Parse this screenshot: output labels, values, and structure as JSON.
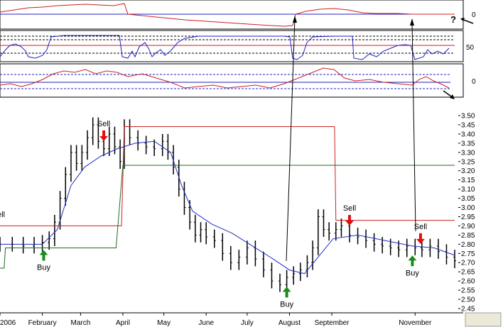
{
  "chart_data": {
    "type": "line",
    "grid": false,
    "legend": "none",
    "colors": {
      "price": "#000000",
      "moving_average": "#1f2fbf",
      "sell_stop": "#cc2222",
      "buy_stop": "#1e6b1e",
      "buy_arrow": "#1a8a1a",
      "sell_arrow": "#e01010",
      "indicator_line": "#cc2020",
      "indicator_blue": "#2020c0"
    },
    "x": {
      "type": "date",
      "range": [
        "2006-01-01",
        "2006-11-30"
      ],
      "ticks": [
        {
          "label": "2006",
          "date": "2006-01-01"
        },
        {
          "label": "February",
          "date": "2006-02-01"
        },
        {
          "label": "March",
          "date": "2006-03-01"
        },
        {
          "label": "April",
          "date": "2006-04-01"
        },
        {
          "label": "May",
          "date": "2006-05-01"
        },
        {
          "label": "June",
          "date": "2006-06-01"
        },
        {
          "label": "July",
          "date": "2006-07-01"
        },
        {
          "label": "August",
          "date": "2006-08-01"
        },
        {
          "label": "September",
          "date": "2006-09-01"
        },
        {
          "label": "November",
          "date": "2006-11-01"
        }
      ]
    },
    "y": {
      "range": [
        2.45,
        3.5
      ],
      "ticks": [
        "3.50",
        "3.45",
        "3.40",
        "3.35",
        "3.30",
        "3.25",
        "3.20",
        "3.15",
        "3.10",
        "3.05",
        "3.00",
        "2.95",
        "2.90",
        "2.85",
        "2.80",
        "2.75",
        "2.70",
        "2.65",
        "2.60",
        "2.55",
        "2.50",
        "2.45"
      ]
    },
    "price_series": [
      {
        "date": "2006-01-01",
        "value": 2.8
      },
      {
        "date": "2006-01-10",
        "value": 2.8
      },
      {
        "date": "2006-01-18",
        "value": 2.79
      },
      {
        "date": "2006-01-26",
        "value": 2.8
      },
      {
        "date": "2006-02-01",
        "value": 2.81
      },
      {
        "date": "2006-02-06",
        "value": 2.83
      },
      {
        "date": "2006-02-10",
        "value": 2.92
      },
      {
        "date": "2006-02-14",
        "value": 3.05
      },
      {
        "date": "2006-02-18",
        "value": 3.18
      },
      {
        "date": "2006-02-22",
        "value": 3.3
      },
      {
        "date": "2006-02-26",
        "value": 3.24
      },
      {
        "date": "2006-03-02",
        "value": 3.3
      },
      {
        "date": "2006-03-06",
        "value": 3.38
      },
      {
        "date": "2006-03-10",
        "value": 3.45
      },
      {
        "date": "2006-03-14",
        "value": 3.36
      },
      {
        "date": "2006-03-18",
        "value": 3.32
      },
      {
        "date": "2006-03-22",
        "value": 3.4
      },
      {
        "date": "2006-03-26",
        "value": 3.33
      },
      {
        "date": "2006-03-30",
        "value": 3.25
      },
      {
        "date": "2006-04-02",
        "value": 3.44
      },
      {
        "date": "2006-04-06",
        "value": 3.38
      },
      {
        "date": "2006-04-12",
        "value": 3.35
      },
      {
        "date": "2006-04-18",
        "value": 3.33
      },
      {
        "date": "2006-04-24",
        "value": 3.32
      },
      {
        "date": "2006-04-30",
        "value": 3.36
      },
      {
        "date": "2006-05-04",
        "value": 3.3
      },
      {
        "date": "2006-05-08",
        "value": 3.22
      },
      {
        "date": "2006-05-12",
        "value": 3.1
      },
      {
        "date": "2006-05-16",
        "value": 3.0
      },
      {
        "date": "2006-05-20",
        "value": 2.92
      },
      {
        "date": "2006-05-24",
        "value": 2.85
      },
      {
        "date": "2006-05-28",
        "value": 2.88
      },
      {
        "date": "2006-06-01",
        "value": 2.84
      },
      {
        "date": "2006-06-07",
        "value": 2.82
      },
      {
        "date": "2006-06-13",
        "value": 2.75
      },
      {
        "date": "2006-06-19",
        "value": 2.7
      },
      {
        "date": "2006-06-25",
        "value": 2.73
      },
      {
        "date": "2006-07-01",
        "value": 2.78
      },
      {
        "date": "2006-07-07",
        "value": 2.72
      },
      {
        "date": "2006-07-13",
        "value": 2.66
      },
      {
        "date": "2006-07-19",
        "value": 2.6
      },
      {
        "date": "2006-07-25",
        "value": 2.58
      },
      {
        "date": "2006-07-30",
        "value": 2.62
      },
      {
        "date": "2006-08-04",
        "value": 2.64
      },
      {
        "date": "2006-08-09",
        "value": 2.66
      },
      {
        "date": "2006-08-14",
        "value": 2.7
      },
      {
        "date": "2006-08-18",
        "value": 2.78
      },
      {
        "date": "2006-08-22",
        "value": 2.95
      },
      {
        "date": "2006-08-26",
        "value": 2.88
      },
      {
        "date": "2006-08-30",
        "value": 2.86
      },
      {
        "date": "2006-09-04",
        "value": 2.88
      },
      {
        "date": "2006-09-08",
        "value": 2.9
      },
      {
        "date": "2006-09-14",
        "value": 2.85
      },
      {
        "date": "2006-09-20",
        "value": 2.84
      },
      {
        "date": "2006-09-26",
        "value": 2.82
      },
      {
        "date": "2006-10-02",
        "value": 2.8
      },
      {
        "date": "2006-10-08",
        "value": 2.79
      },
      {
        "date": "2006-10-14",
        "value": 2.78
      },
      {
        "date": "2006-10-20",
        "value": 2.77
      },
      {
        "date": "2006-10-26",
        "value": 2.79
      },
      {
        "date": "2006-11-01",
        "value": 2.78
      },
      {
        "date": "2006-11-06",
        "value": 2.77
      },
      {
        "date": "2006-11-12",
        "value": 2.79
      },
      {
        "date": "2006-11-18",
        "value": 2.76
      },
      {
        "date": "2006-11-24",
        "value": 2.73
      },
      {
        "date": "2006-11-30",
        "value": 2.71
      }
    ],
    "moving_average": [
      {
        "date": "2006-01-01",
        "value": 2.8
      },
      {
        "date": "2006-02-01",
        "value": 2.8
      },
      {
        "date": "2006-02-12",
        "value": 2.88
      },
      {
        "date": "2006-02-22",
        "value": 3.12
      },
      {
        "date": "2006-03-04",
        "value": 3.22
      },
      {
        "date": "2006-03-16",
        "value": 3.28
      },
      {
        "date": "2006-03-28",
        "value": 3.32
      },
      {
        "date": "2006-04-10",
        "value": 3.35
      },
      {
        "date": "2006-04-24",
        "value": 3.36
      },
      {
        "date": "2006-05-06",
        "value": 3.3
      },
      {
        "date": "2006-05-14",
        "value": 3.12
      },
      {
        "date": "2006-05-22",
        "value": 2.98
      },
      {
        "date": "2006-06-05",
        "value": 2.91
      },
      {
        "date": "2006-06-20",
        "value": 2.86
      },
      {
        "date": "2006-07-05",
        "value": 2.79
      },
      {
        "date": "2006-07-20",
        "value": 2.72
      },
      {
        "date": "2006-08-01",
        "value": 2.66
      },
      {
        "date": "2006-08-12",
        "value": 2.64
      },
      {
        "date": "2006-08-22",
        "value": 2.73
      },
      {
        "date": "2006-09-02",
        "value": 2.83
      },
      {
        "date": "2006-09-20",
        "value": 2.85
      },
      {
        "date": "2006-10-10",
        "value": 2.82
      },
      {
        "date": "2006-10-30",
        "value": 2.79
      },
      {
        "date": "2006-11-15",
        "value": 2.78
      },
      {
        "date": "2006-11-30",
        "value": 2.74
      }
    ],
    "sell_stop_line": [
      {
        "date": "2006-01-01",
        "value": 2.9
      },
      {
        "date": "2006-03-31",
        "value": 2.9
      },
      {
        "date": "2006-04-02",
        "value": 3.44
      },
      {
        "date": "2006-09-03",
        "value": 3.44
      },
      {
        "date": "2006-09-04",
        "value": 2.93
      },
      {
        "date": "2006-11-30",
        "value": 2.93
      }
    ],
    "buy_stop_line": [
      {
        "date": "2006-01-01",
        "value": 2.67
      },
      {
        "date": "2006-01-04",
        "value": 2.67
      },
      {
        "date": "2006-01-05",
        "value": 2.78
      },
      {
        "date": "2006-03-27",
        "value": 2.78
      },
      {
        "date": "2006-04-01",
        "value": 3.23
      },
      {
        "date": "2006-11-30",
        "value": 3.23
      }
    ],
    "annotations": [
      {
        "text": "Buy",
        "type": "buy",
        "date": "2006-02-02",
        "value": 2.78
      },
      {
        "text": "Sell",
        "type": "sell",
        "date": "2006-03-18",
        "value": 3.35
      },
      {
        "text": "Buy",
        "type": "buy",
        "date": "2006-07-30",
        "value": 2.58
      },
      {
        "text": "Sell",
        "type": "sell",
        "date": "2006-09-14",
        "value": 2.89
      },
      {
        "text": "Buy",
        "type": "buy",
        "date": "2006-10-30",
        "value": 2.75
      },
      {
        "text": "Sell",
        "type": "sell",
        "date": "2006-11-05",
        "value": 2.79
      }
    ],
    "left_edge_label": "ell",
    "top_panel": {
      "label": "0",
      "help_mark": "?"
    },
    "middle_panel": {
      "label": "50"
    },
    "bottom_panel": {
      "label": "0"
    }
  }
}
